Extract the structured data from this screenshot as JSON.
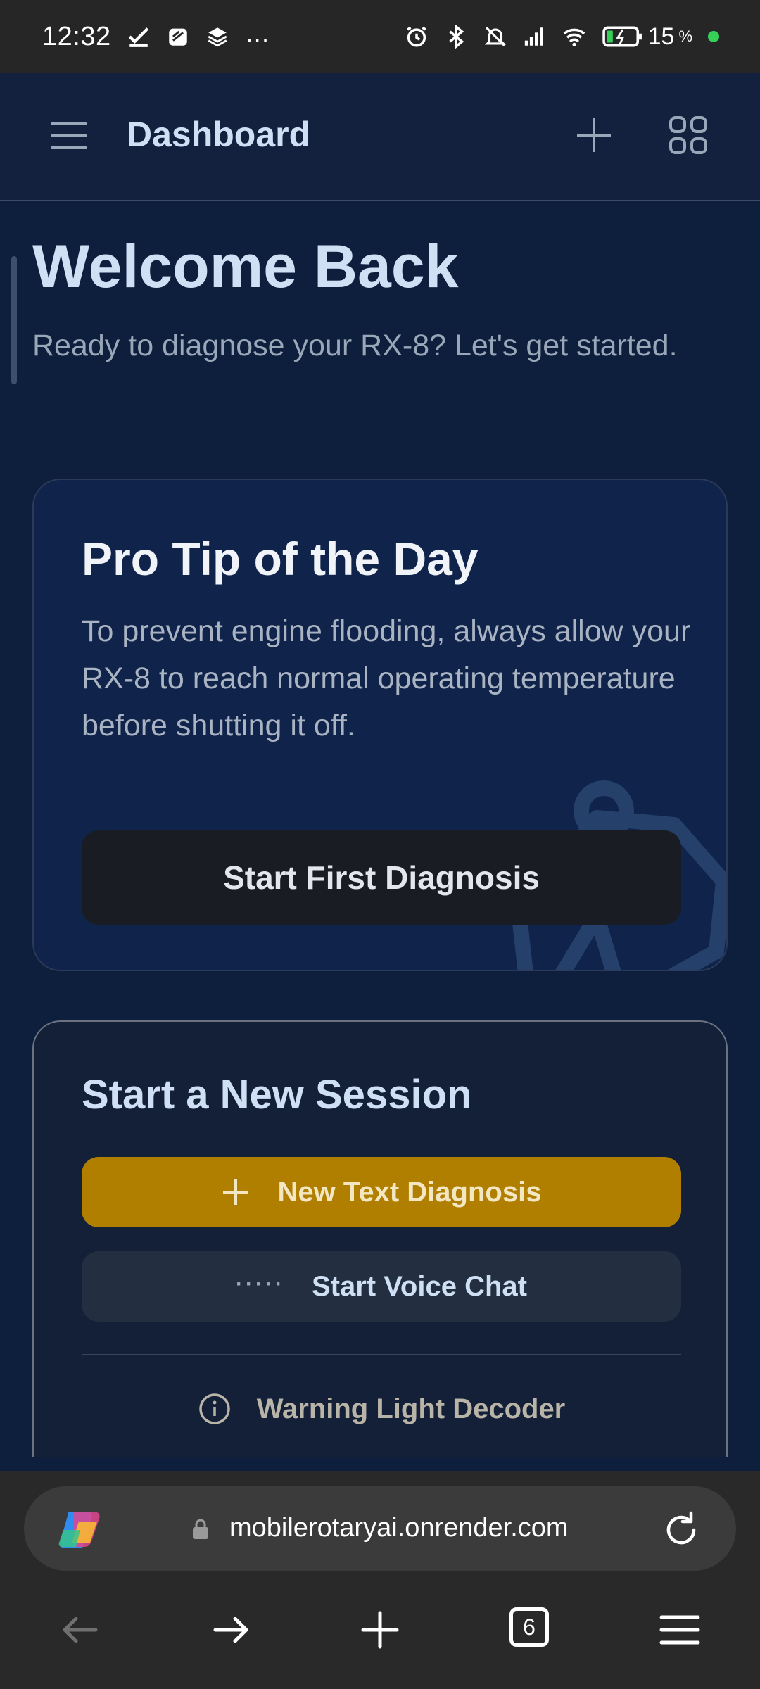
{
  "status_bar": {
    "time": "12:32",
    "battery_percent": "15",
    "battery_suffix": "%",
    "overflow": "…",
    "icons": [
      "check-icon",
      "package-icon",
      "layers-icon",
      "alarm-icon",
      "bluetooth-icon",
      "mute-icon",
      "signal-icon",
      "wifi-icon",
      "battery-icon"
    ]
  },
  "header": {
    "title": "Dashboard",
    "icons": [
      "menu-icon",
      "plus-icon",
      "grid-icon"
    ]
  },
  "welcome": {
    "title": "Welcome Back",
    "subtitle": "Ready to diagnose your RX-8? Let's get started."
  },
  "tip_card": {
    "title": "Pro Tip of the Day",
    "body": "To prevent engine flooding, always allow your RX-8 to reach normal operating temperature before shutting it off.",
    "button_label": "Start First Diagnosis"
  },
  "session_card": {
    "title": "Start a New Session",
    "text_diagnosis_label": "New Text Diagnosis",
    "voice_chat_label": "Start Voice Chat",
    "voice_dots": "·····",
    "warning_decoder_label": "Warning Light Decoder"
  },
  "browser": {
    "url": "mobilerotaryai.onrender.com",
    "tab_count": "6"
  },
  "colors": {
    "page_bg": "#0d1f3d",
    "header_bg": "#13213f",
    "accent_gold": "#b07f00",
    "browser_bg": "#292929"
  }
}
